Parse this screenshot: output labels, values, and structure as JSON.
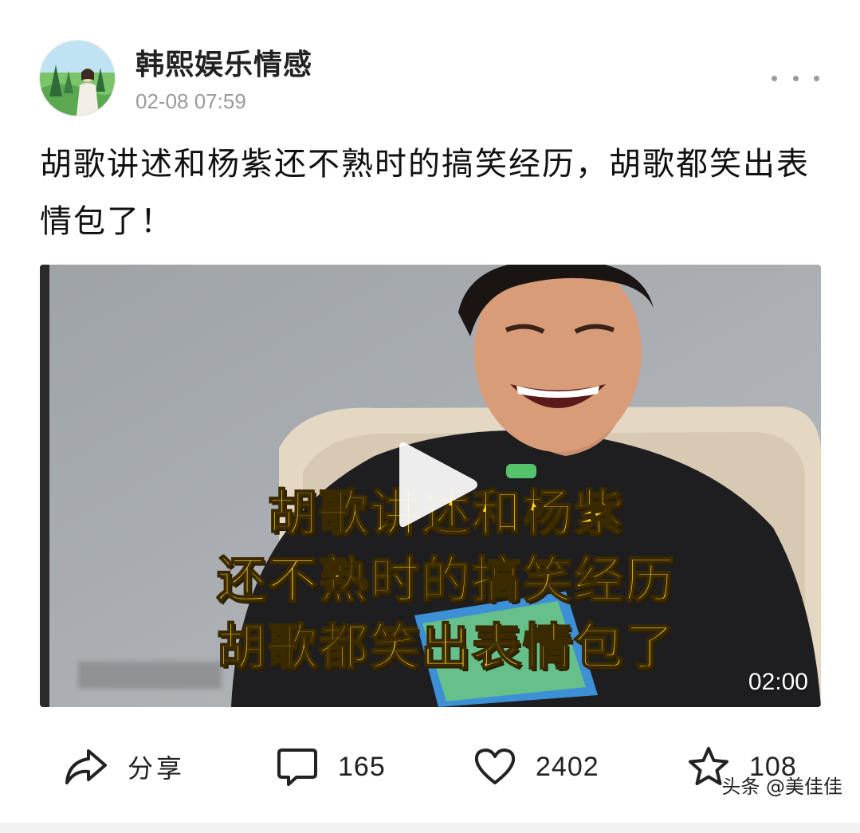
{
  "author": {
    "name": "韩熙娱乐情感",
    "post_time": "02-08 07:59",
    "avatar_icon": "avatar-photo"
  },
  "post": {
    "title": "胡歌讲述和杨紫还不熟时的搞笑经历，胡歌都笑出表情包了！"
  },
  "video": {
    "caption_lines": [
      "胡歌讲述和杨紫",
      "还不熟时的搞笑经历",
      "胡歌都笑出表情包了"
    ],
    "duration": "02:00",
    "caption_color": "#ffd21a"
  },
  "actions": {
    "share_label": "分享",
    "comment_count": "165",
    "like_count": "2402",
    "favorite_count": "108"
  },
  "watermark": "头条 @美佳佳"
}
